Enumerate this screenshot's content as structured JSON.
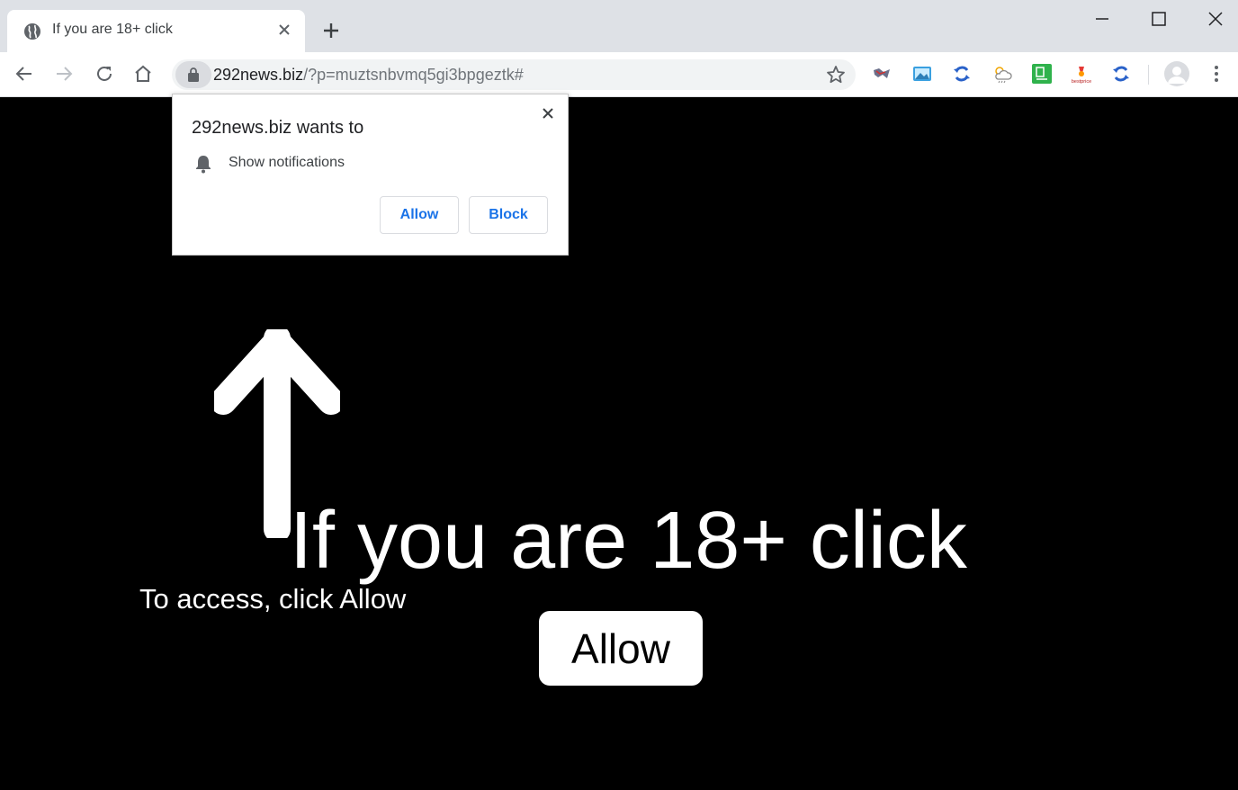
{
  "browser": {
    "tab": {
      "title": "If you are 18+ click",
      "favicon": "globe-icon"
    },
    "new_tab_icon": "plus-icon",
    "window_controls": [
      "minimize-icon",
      "maximize-icon",
      "close-icon"
    ],
    "url": {
      "host": "292news.biz",
      "path": "/?p=muztsnbvmq5gi3bpgeztk#"
    },
    "extensions": [
      "map-extension",
      "photo-extension",
      "sync-extension",
      "weather-extension",
      "spreadsheet-extension",
      "bestprice-extension",
      "sync-extension-2"
    ],
    "extension_text": {
      "bestprice": "bestprice"
    }
  },
  "popup": {
    "title": "292news.biz wants to",
    "permission": "Show notifications",
    "allow_label": "Allow",
    "block_label": "Block"
  },
  "page": {
    "headline": "If you are 18+ click",
    "subline": "To access, click Allow",
    "allow_button": "Allow"
  }
}
